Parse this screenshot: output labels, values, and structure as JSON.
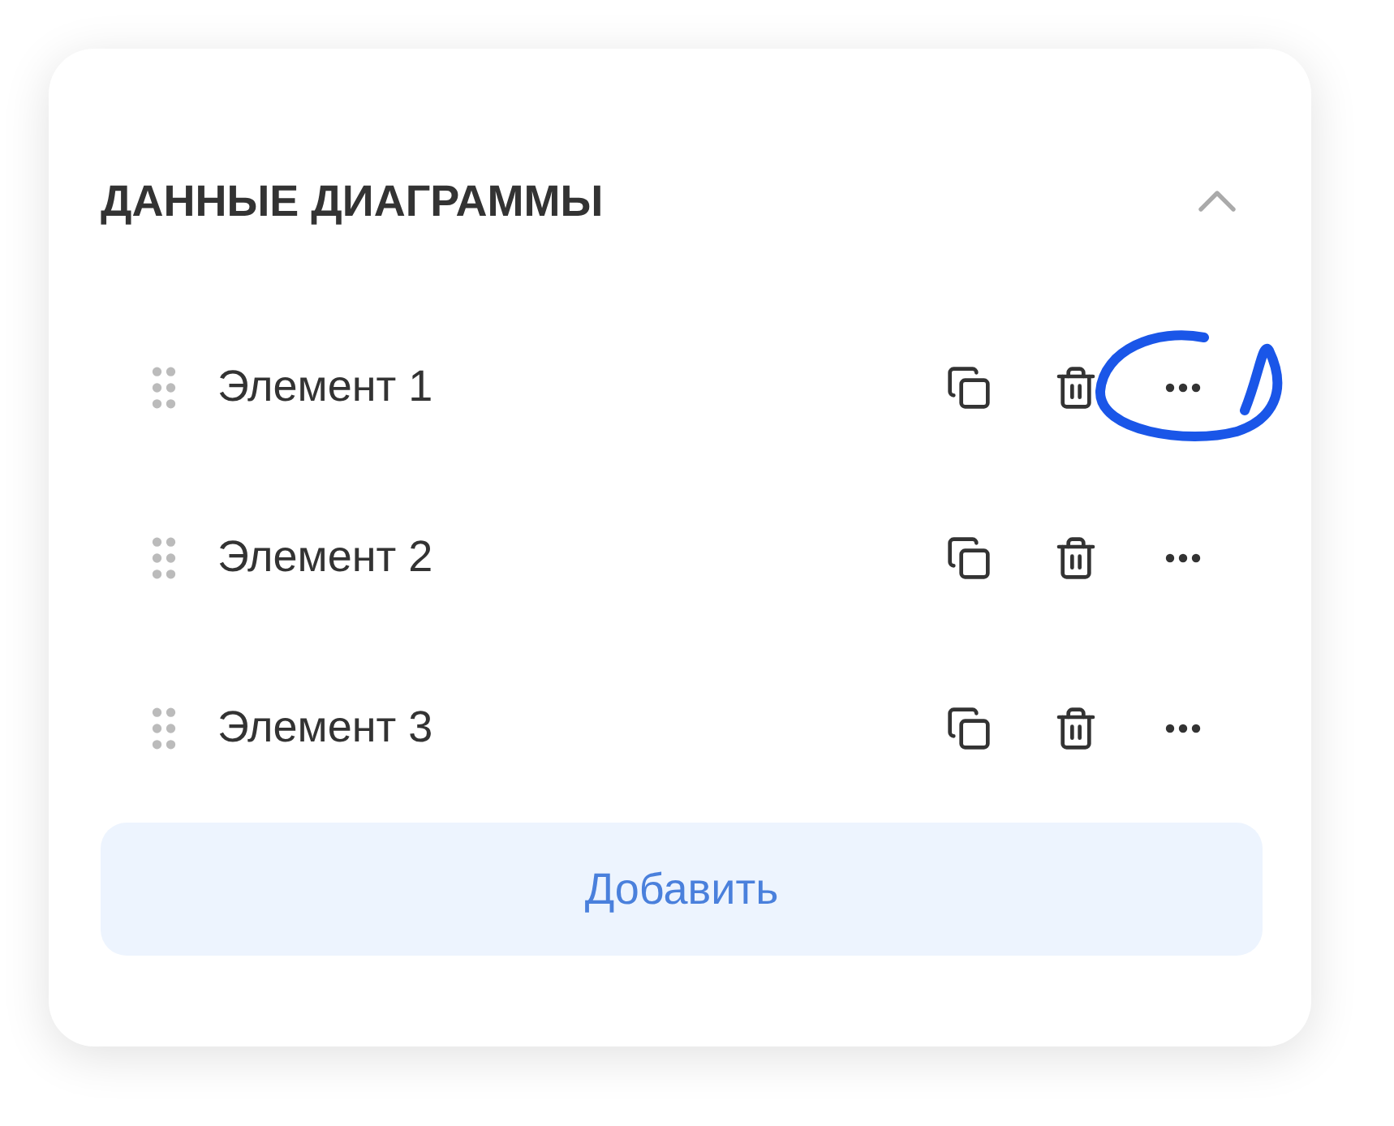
{
  "panel": {
    "title": "ДАННЫЕ ДИАГРАММЫ",
    "expanded": true
  },
  "items": [
    {
      "label": "Элемент 1",
      "circled": true
    },
    {
      "label": "Элемент 2",
      "circled": false
    },
    {
      "label": "Элемент 3",
      "circled": false
    }
  ],
  "add_button": "Добавить"
}
